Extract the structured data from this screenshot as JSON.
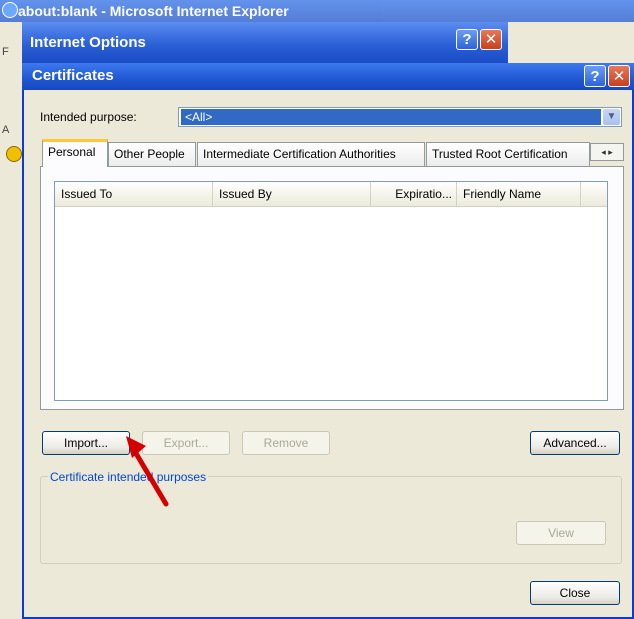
{
  "background_window": {
    "title": "about:blank - Microsoft Internet Explorer",
    "left_labels": [
      "F",
      "A"
    ]
  },
  "internet_options": {
    "title": "Internet Options",
    "help_label": "?",
    "close_label": "✕"
  },
  "certificates": {
    "title": "Certificates",
    "help_label": "?",
    "close_label": "✕",
    "intended_purpose_label": "Intended purpose:",
    "intended_purpose_value": "<All>",
    "tabs": [
      {
        "label": "Personal",
        "active": true
      },
      {
        "label": "Other People",
        "active": false
      },
      {
        "label": "Intermediate Certification Authorities",
        "active": false
      },
      {
        "label": "Trusted Root Certification",
        "active": false
      }
    ],
    "tab_scroll_label": "◂ ▸",
    "columns": [
      "Issued To",
      "Issued By",
      "Expiratio...",
      "Friendly Name"
    ],
    "buttons": {
      "import": "Import...",
      "export": "Export...",
      "remove": "Remove",
      "advanced": "Advanced...",
      "view": "View",
      "close": "Close"
    },
    "purposes_group_label": "Certificate intended purposes"
  },
  "colors": {
    "titlebar": "#1f57d2",
    "selection": "#316ac5",
    "annotation_arrow": "#d40000"
  }
}
